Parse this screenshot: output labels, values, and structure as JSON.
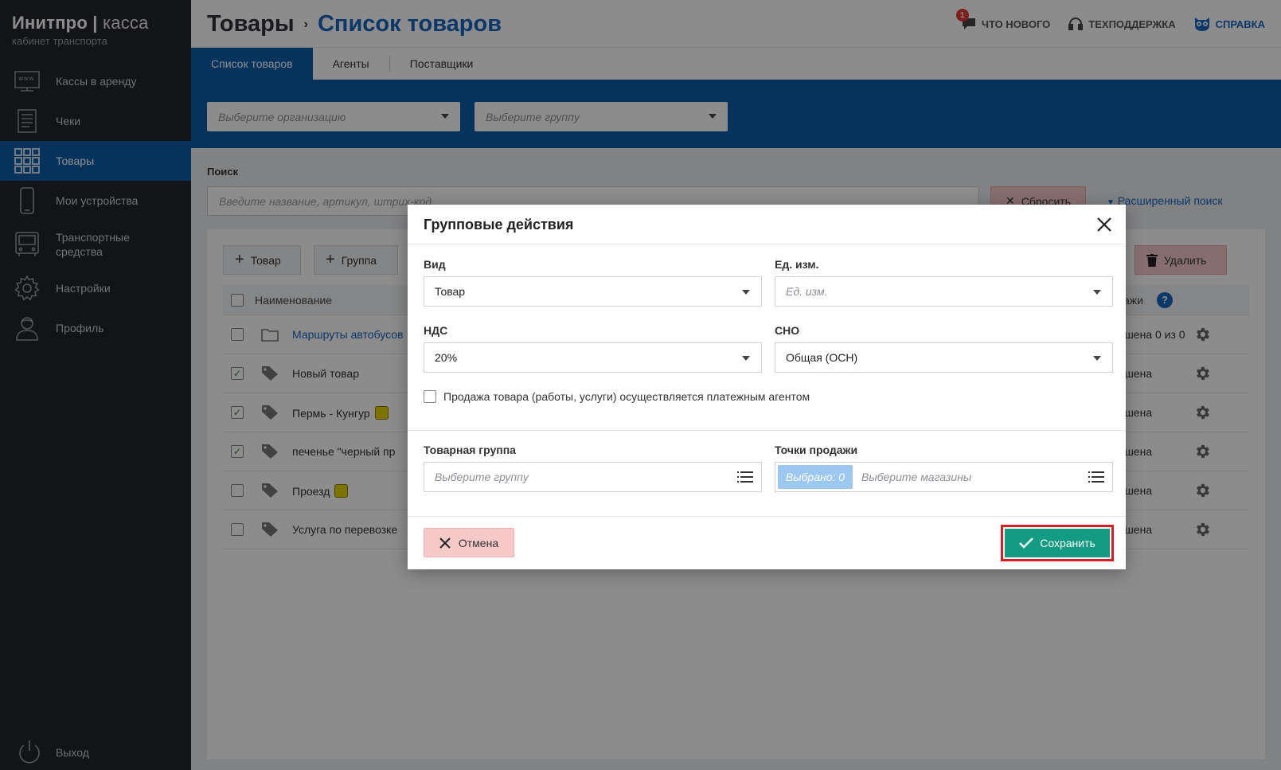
{
  "brand": {
    "name": "Инитпро",
    "sep": "|",
    "product": "касса",
    "subtitle": "кабинет транспорта"
  },
  "sidebar": {
    "items": [
      {
        "label": "Кассы в аренду",
        "icon": "www-terminal-icon"
      },
      {
        "label": "Чеки",
        "icon": "receipt-icon"
      },
      {
        "label": "Товары",
        "icon": "grid-icon",
        "active": true
      },
      {
        "label": "Мои устройства",
        "icon": "phone-icon"
      },
      {
        "label": "Транспортные средства",
        "icon": "bus-icon"
      },
      {
        "label": "Настройки",
        "icon": "gear-icon"
      },
      {
        "label": "Профиль",
        "icon": "user-icon"
      }
    ],
    "logout": "Выход"
  },
  "header": {
    "section": "Товары",
    "page": "Список товаров",
    "links": {
      "whats_new": "ЧТО НОВОГО",
      "whats_new_badge": "1",
      "support": "ТЕХПОДДЕРЖКА",
      "help": "СПРАВКА"
    }
  },
  "tabs": [
    "Список товаров",
    "Агенты",
    "Поставщики"
  ],
  "filters": {
    "org_placeholder": "Выберите организацию",
    "group_placeholder": "Выберите группу"
  },
  "search": {
    "label": "Поиск",
    "placeholder": "Введите название, артикул, штрих-код",
    "reset": "Сбросить",
    "advanced": "Расширенный поиск"
  },
  "toolbar": {
    "add_item": "Товар",
    "add_group": "Группа",
    "partial_hidden": "ть",
    "delete": "Удалить"
  },
  "table": {
    "col_name": "Наименование",
    "col_sales": "продажи",
    "rows": [
      {
        "name": "Маршруты автобусов",
        "type": "folder",
        "checked": false,
        "status": "решена 0 из 0",
        "link": true,
        "ticket": false
      },
      {
        "name": "Новый товар",
        "type": "tag",
        "checked": true,
        "status": "решена",
        "link": false,
        "ticket": false
      },
      {
        "name": "Пермь - Кунгур",
        "type": "tag",
        "checked": true,
        "status": "решена",
        "link": false,
        "ticket": true
      },
      {
        "name": "печенье \"черный пр",
        "type": "tag",
        "checked": true,
        "status": "решена",
        "link": false,
        "ticket": false
      },
      {
        "name": "Проезд",
        "type": "tag",
        "checked": false,
        "status": "решена",
        "link": false,
        "ticket": true
      },
      {
        "name": "Услуга по перевозке",
        "type": "tag",
        "checked": false,
        "status": "решена",
        "link": false,
        "ticket": false
      }
    ]
  },
  "modal": {
    "title": "Групповые действия",
    "vid_label": "Вид",
    "vid_value": "Товар",
    "unit_label": "Ед. изм.",
    "unit_placeholder": "Ед. изм.",
    "vat_label": "НДС",
    "vat_value": "20%",
    "sno_label": "СНО",
    "sno_value": "Общая (ОСН)",
    "agent_checkbox": "Продажа товара (работы, услуги) осуществляется платежным агентом",
    "group_label": "Товарная группа",
    "group_placeholder": "Выберите группу",
    "points_label": "Точки продажи",
    "points_chosen": "Выбрано: 0",
    "points_placeholder": "Выберите магазины",
    "cancel": "Отмена",
    "save": "Сохранить"
  },
  "colors": {
    "sidebar": "#22262c",
    "primary": "#0b5ea8",
    "link": "#1565c0",
    "save": "#139b83",
    "cancel": "#f6c9c9",
    "highlight": "#e01a22"
  }
}
